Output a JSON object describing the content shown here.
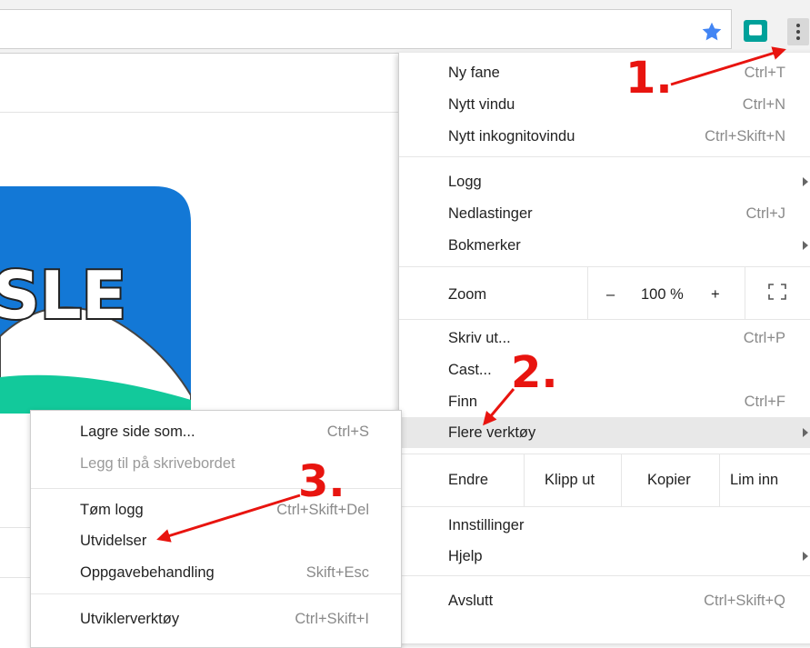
{
  "toolbar": {
    "icons": [
      "star-icon",
      "extension-icon",
      "more-vert-icon"
    ],
    "accent": "#4285f4"
  },
  "logo": {
    "text": "SLE",
    "colors": {
      "blue": "#1378d6",
      "green": "#12c99b"
    }
  },
  "main_menu": {
    "items_group1": [
      {
        "label": "Ny fane",
        "shortcut": "Ctrl+T"
      },
      {
        "label": "Nytt vindu",
        "shortcut": "Ctrl+N"
      },
      {
        "label": "Nytt inkognitovindu",
        "shortcut": "Ctrl+Skift+N"
      }
    ],
    "items_group2": [
      {
        "label": "Logg",
        "submenu": true
      },
      {
        "label": "Nedlastinger",
        "shortcut": "Ctrl+J"
      },
      {
        "label": "Bokmerker",
        "submenu": true
      }
    ],
    "zoom": {
      "label": "Zoom",
      "minus": "–",
      "value": "100 %",
      "plus": "+"
    },
    "items_group3": [
      {
        "label": "Skriv ut...",
        "shortcut": "Ctrl+P"
      },
      {
        "label": "Cast..."
      },
      {
        "label": "Finn",
        "shortcut": "Ctrl+F"
      },
      {
        "label": "Flere verktøy",
        "submenu": true,
        "highlighted": true
      }
    ],
    "edit": {
      "label": "Endre",
      "cut": "Klipp ut",
      "copy": "Kopier",
      "paste": "Lim inn"
    },
    "items_group4": [
      {
        "label": "Innstillinger"
      },
      {
        "label": "Hjelp",
        "submenu": true
      }
    ],
    "exit": {
      "label": "Avslutt",
      "shortcut": "Ctrl+Skift+Q"
    }
  },
  "sub_menu": {
    "items": [
      {
        "label": "Lagre side som...",
        "shortcut": "Ctrl+S"
      },
      {
        "label": "Legg til på skrivebordet",
        "disabled": true
      },
      {
        "label": "Tøm logg",
        "shortcut": "Ctrl+Skift+Del"
      },
      {
        "label": "Utvidelser"
      },
      {
        "label": "Oppgavebehandling",
        "shortcut": "Skift+Esc"
      },
      {
        "label": "Utviklerverktøy",
        "shortcut": "Ctrl+Skift+I"
      }
    ]
  },
  "annotations": {
    "step1": "1.",
    "step2": "2.",
    "step3": "3.",
    "color": "#e8140f"
  }
}
